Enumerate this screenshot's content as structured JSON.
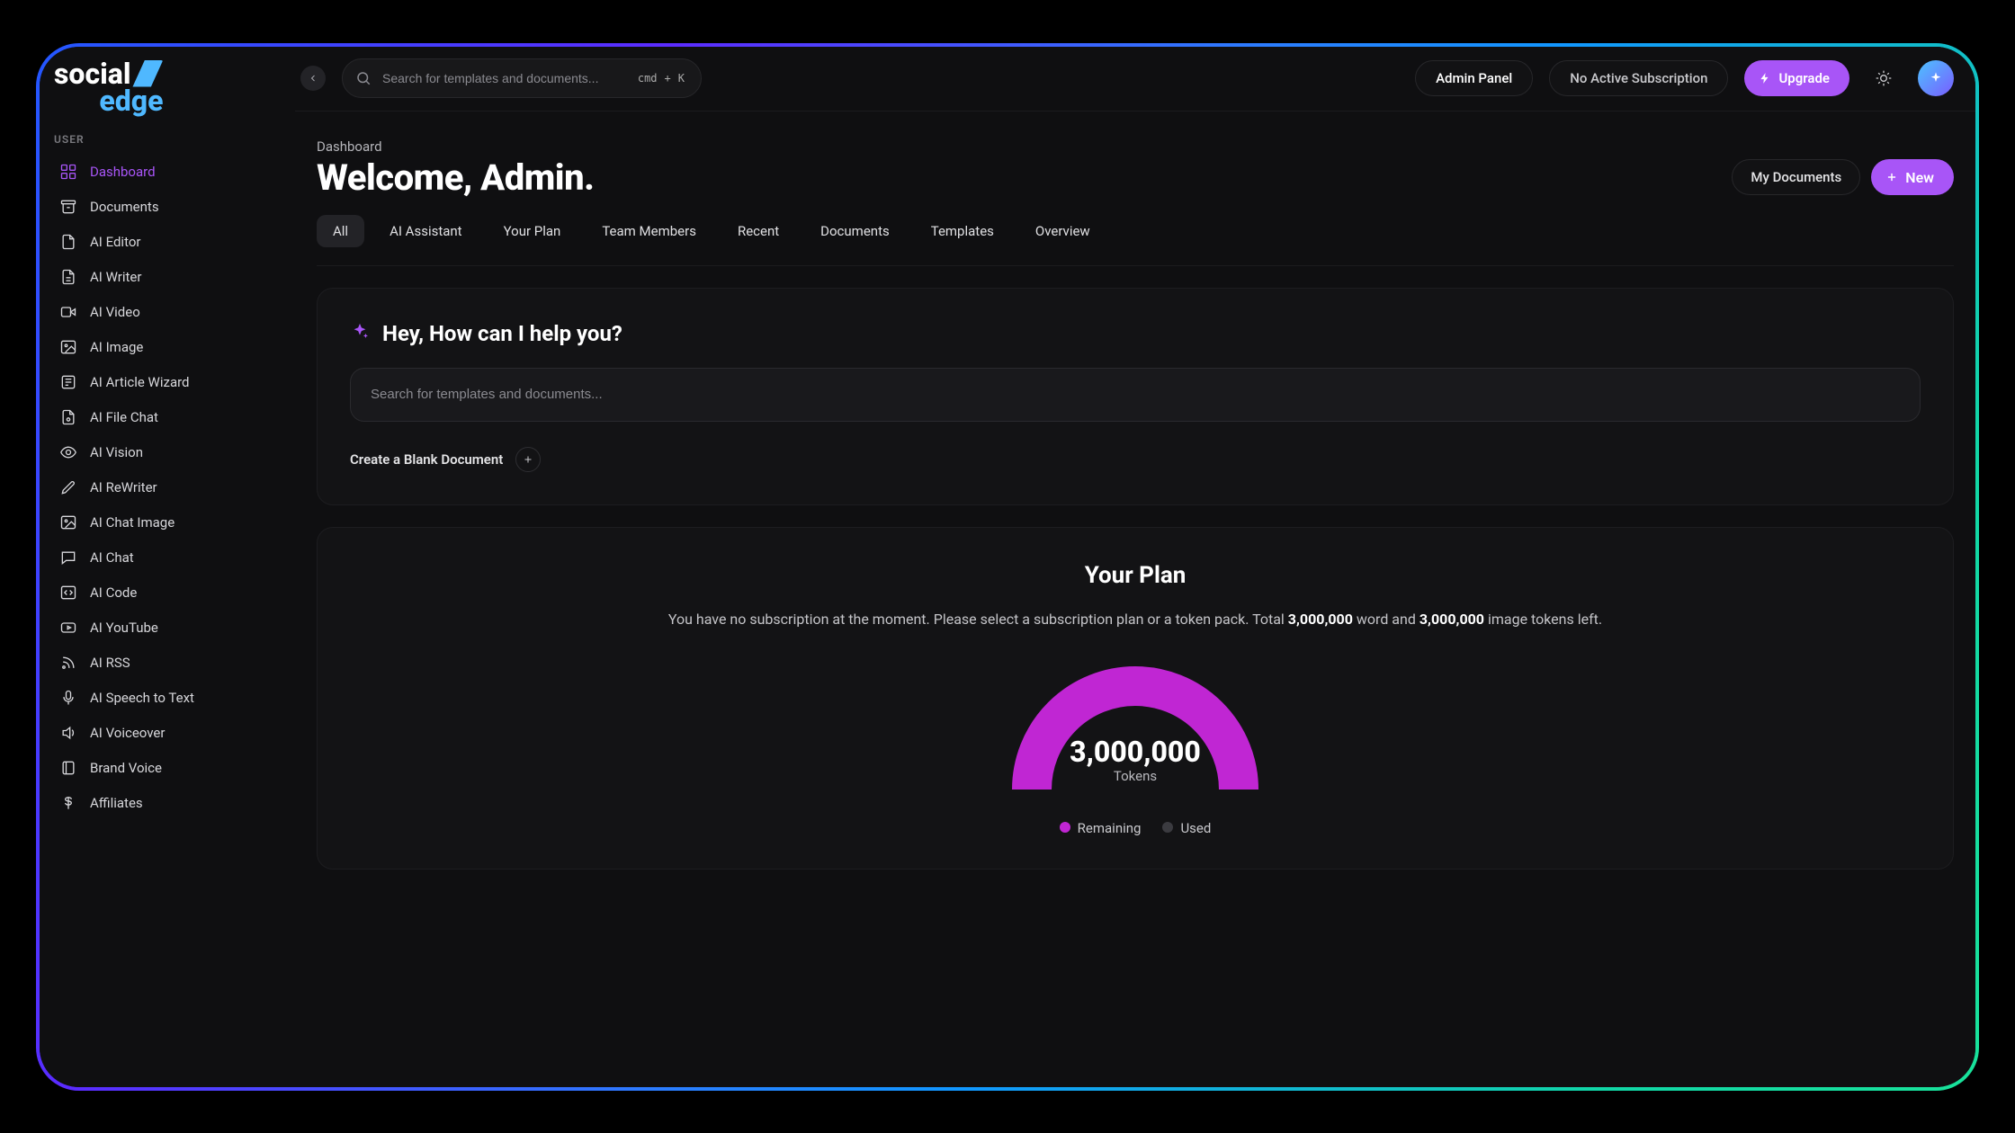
{
  "logo": {
    "part1": "social",
    "part2": "edge"
  },
  "sidebar": {
    "section_label": "USER",
    "items": [
      {
        "label": "Dashboard"
      },
      {
        "label": "Documents"
      },
      {
        "label": "AI Editor"
      },
      {
        "label": "AI Writer"
      },
      {
        "label": "AI Video"
      },
      {
        "label": "AI Image"
      },
      {
        "label": "AI Article Wizard"
      },
      {
        "label": "AI File Chat"
      },
      {
        "label": "AI Vision"
      },
      {
        "label": "AI ReWriter"
      },
      {
        "label": "AI Chat Image"
      },
      {
        "label": "AI Chat"
      },
      {
        "label": "AI Code"
      },
      {
        "label": "AI YouTube"
      },
      {
        "label": "AI RSS"
      },
      {
        "label": "AI Speech to Text"
      },
      {
        "label": "AI Voiceover"
      },
      {
        "label": "Brand Voice"
      },
      {
        "label": "Affiliates"
      }
    ]
  },
  "topbar": {
    "search_placeholder": "Search for templates and documents...",
    "kbd1": "cmd",
    "kbd_plus": "+",
    "kbd2": "K",
    "admin_panel": "Admin Panel",
    "subscription": "No Active Subscription",
    "upgrade": "Upgrade"
  },
  "page": {
    "breadcrumb": "Dashboard",
    "title": "Welcome, Admin.",
    "my_documents": "My Documents",
    "new_btn": "New"
  },
  "tabs": [
    {
      "label": "All"
    },
    {
      "label": "AI Assistant"
    },
    {
      "label": "Your Plan"
    },
    {
      "label": "Team Members"
    },
    {
      "label": "Recent"
    },
    {
      "label": "Documents"
    },
    {
      "label": "Templates"
    },
    {
      "label": "Overview"
    }
  ],
  "assistant": {
    "heading": "Hey, How can I help you?",
    "placeholder": "Search for templates and documents...",
    "create_blank": "Create a Blank Document"
  },
  "plan": {
    "title": "Your Plan",
    "desc_pre": "You have no subscription at the moment. Please select a subscription plan or a token pack. Total ",
    "word_tokens": "3,000,000",
    "desc_mid": " word and ",
    "image_tokens": "3,000,000",
    "desc_post": " image tokens left.",
    "gauge_value": "3,000,000",
    "gauge_label": "Tokens",
    "legend_remaining": "Remaining",
    "legend_used": "Used"
  },
  "colors": {
    "accent": "#a855f7",
    "magenta": "#c026d3",
    "blue": "#4fb8ff"
  },
  "chart_data": {
    "type": "pie",
    "series": [
      {
        "name": "Remaining",
        "value": 3000000,
        "color": "#c026d3"
      },
      {
        "name": "Used",
        "value": 0,
        "color": "#3b3b40"
      }
    ],
    "title": "Tokens",
    "total": 3000000
  }
}
